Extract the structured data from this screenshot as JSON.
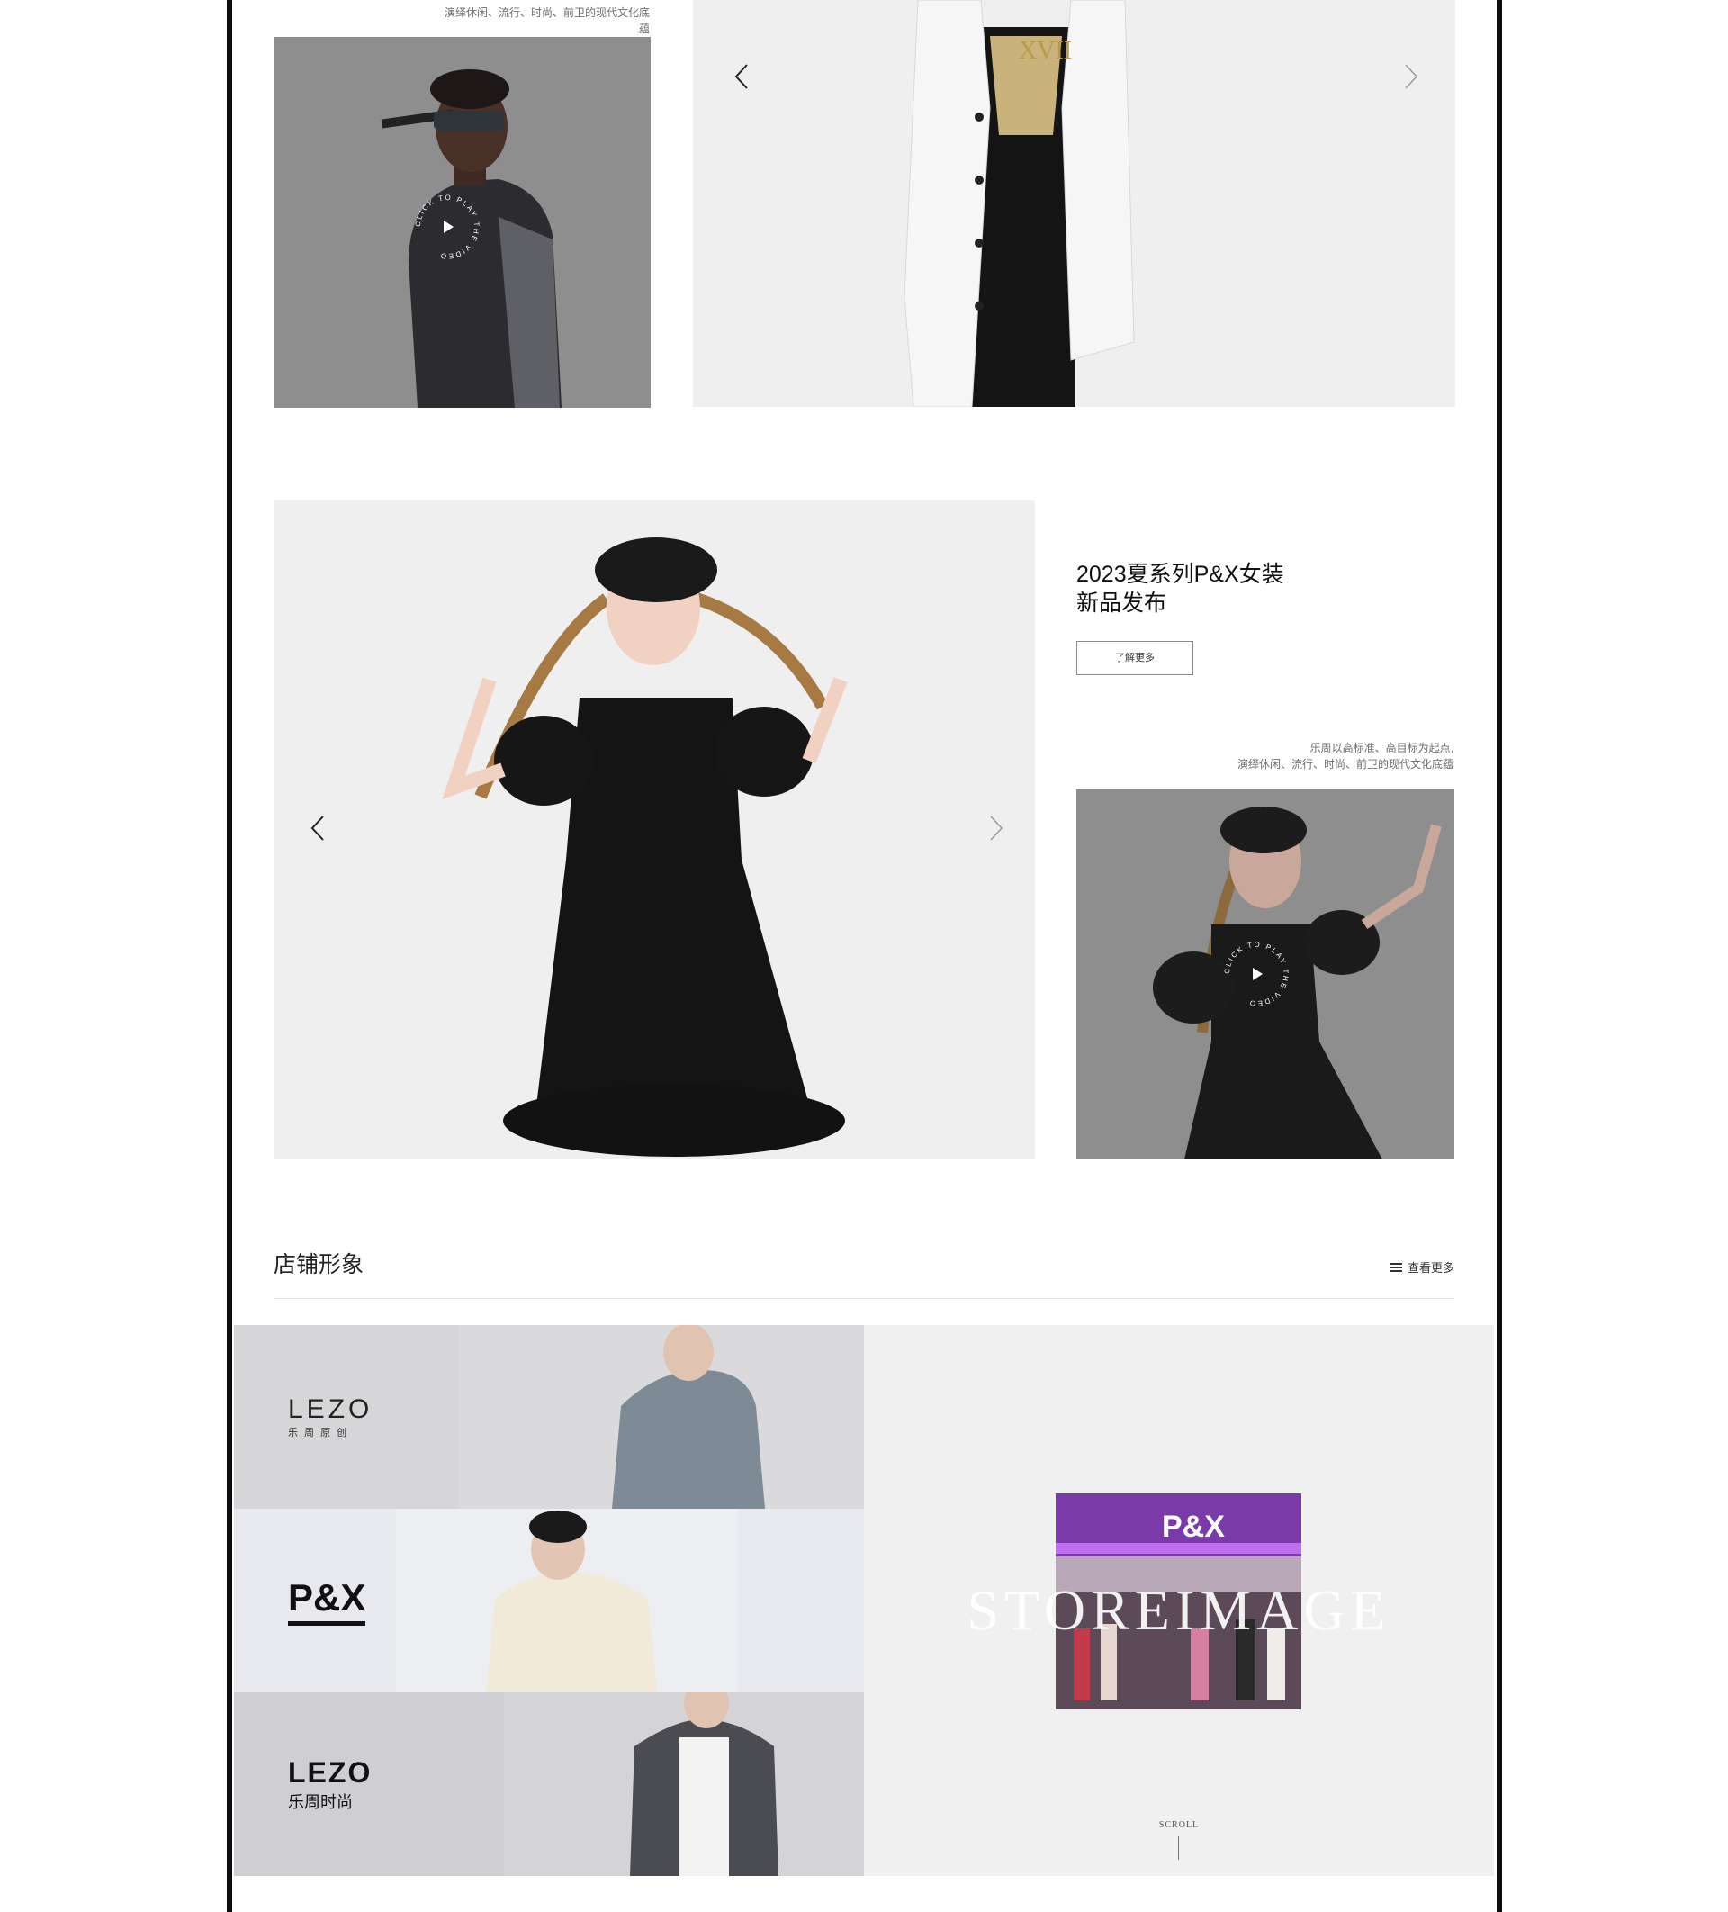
{
  "colors": {
    "frame": "#0c0c0c",
    "overlay_gray": "#8e8e8e",
    "light_panel": "#f0f0f0",
    "store_purple": "#8d3fc8"
  },
  "top": {
    "slogan_line2": "演绎休闲、流行、时尚、前卫的现代文化底蕴",
    "video_label": "CLICK TO PLAY THE VIDEO"
  },
  "feature": {
    "title_line1": "2023夏系列P&X女装",
    "title_line2": "新品发布",
    "more_button": "了解更多",
    "slogan_line1": "乐周以高标准、高目标为起点,",
    "slogan_line2": "演绎休闲、流行、时尚、前卫的现代文化底蕴",
    "video_label": "CLICK TO PLAY THE VIDEO"
  },
  "store": {
    "section_title": "店铺形象",
    "view_more": "查看更多",
    "brands": [
      {
        "logo": "LEZO",
        "sub": "乐 周 原 创"
      },
      {
        "logo": "P&X"
      },
      {
        "logo": "LEZO",
        "sub": "乐周时尚"
      }
    ],
    "sign_text": "P&X",
    "big_word": "STOREIMAGE",
    "scroll_label": "SCROLL"
  },
  "icons": {
    "prev": "chevron-left-icon",
    "next": "chevron-right-icon",
    "play": "play-icon",
    "list": "list-icon"
  }
}
